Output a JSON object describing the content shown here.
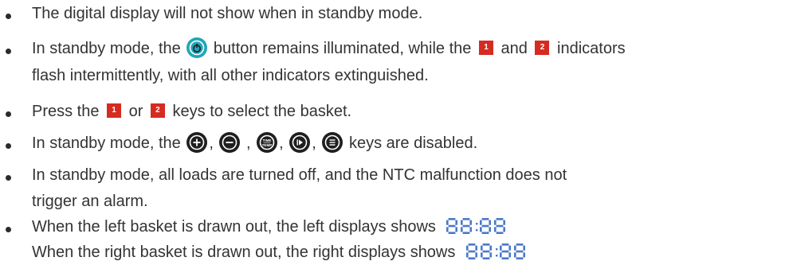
{
  "items": [
    {
      "parts": [
        "The digital display will not show when in standby mode."
      ]
    },
    {
      "parts": [
        "In standby mode, the ",
        " button remains illuminated, while the ",
        "1",
        " and ",
        "2",
        " indicators",
        "flash intermittently, with all other indicators extinguished."
      ]
    },
    {
      "parts": [
        "Press the ",
        "1",
        " or ",
        "2",
        " keys to select the basket."
      ]
    },
    {
      "parts": [
        "In standby mode, the ",
        ",",
        " ,",
        ",",
        ",",
        " keys are disabled."
      ],
      "icons": [
        "plus-icon",
        "minus-icon",
        "time-temp-icon",
        "play-icon",
        "menu-icon"
      ],
      "time_temp_label_top": "TIME",
      "time_temp_label_bottom": "TEMP"
    },
    {
      "parts": [
        "In standby mode, all loads are turned off, and the NTC malfunction does not",
        "trigger an alarm."
      ]
    },
    {
      "parts": [
        "When the left basket is drawn out, the left displays shows ",
        "When the right basket is drawn out, the right displays shows "
      ]
    }
  ],
  "colors": {
    "indicator_red": "#d52b20",
    "power_teal": "#1fa6b8",
    "segment_blue": "#4a78c8"
  }
}
